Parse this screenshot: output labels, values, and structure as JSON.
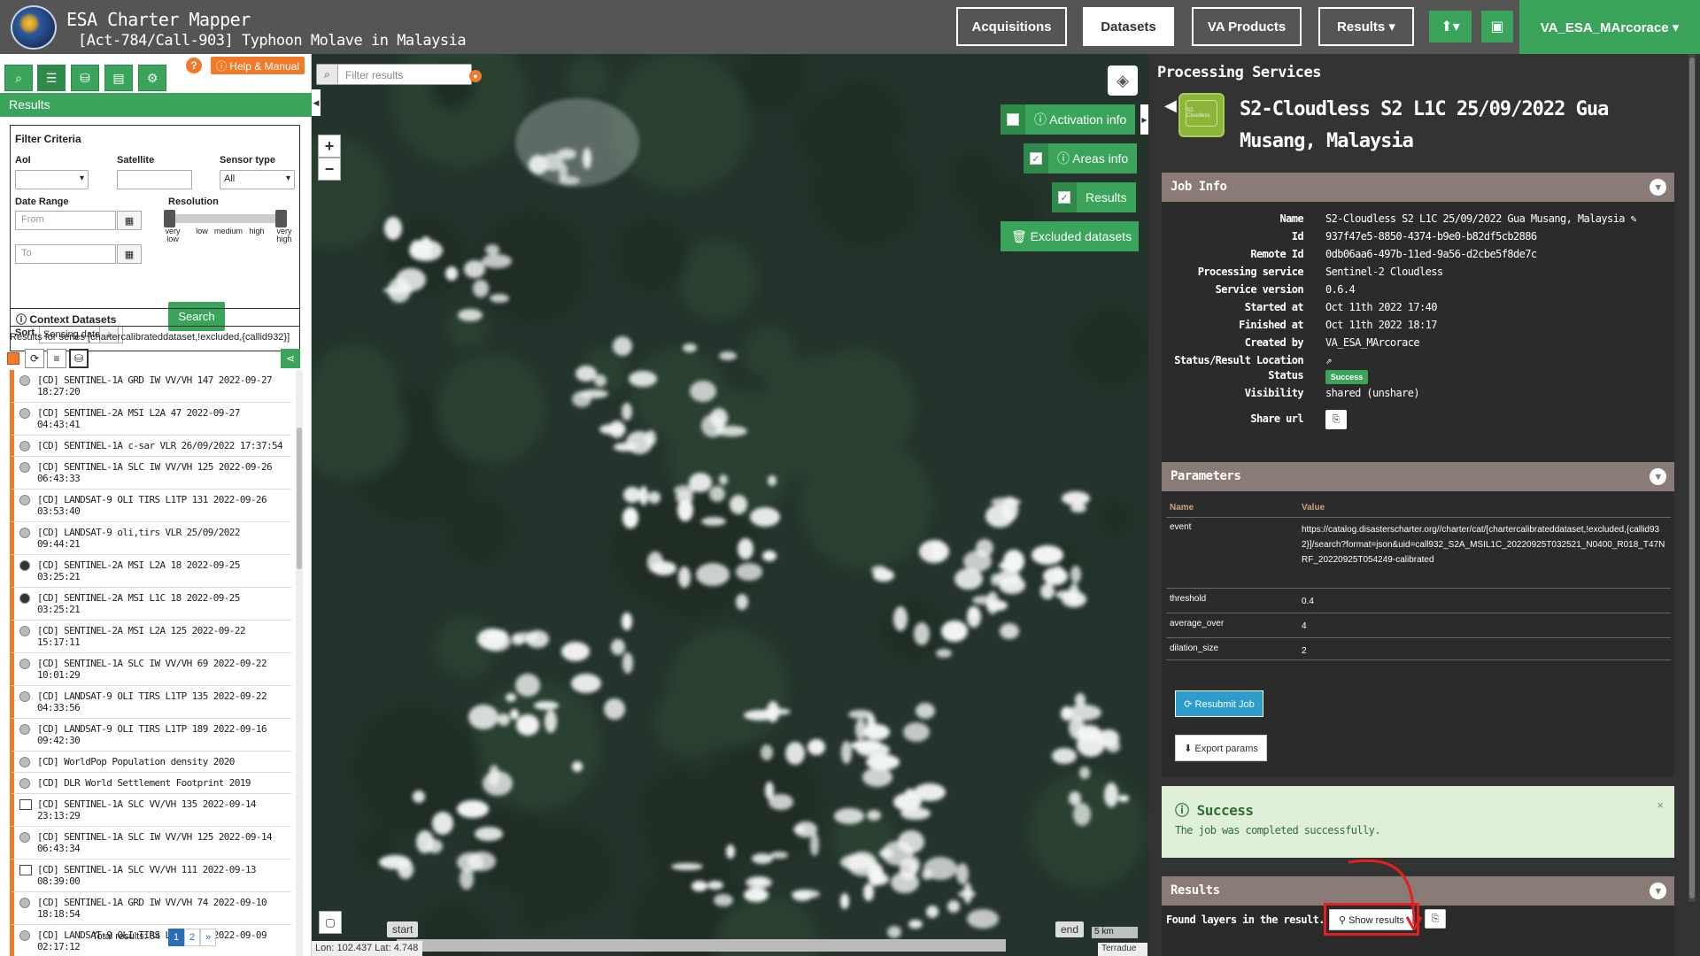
{
  "header": {
    "app_title": "ESA Charter Mapper",
    "activation_title": "[Act-784/Call-903] Typhoon Molave in Malaysia",
    "nav": [
      {
        "label": "Acquisitions"
      },
      {
        "label": "Datasets"
      },
      {
        "label": "VA Products"
      },
      {
        "label": "Results ▾"
      }
    ],
    "upload_label": "⬆▾",
    "briefcase_label": "▣",
    "user_label": "VA_ESA_MArcorace ▾"
  },
  "left_panel": {
    "help_q": "?",
    "help_manual": "ⓘ Help & Manual",
    "tab_icons": [
      "⌕",
      "☰",
      "⛁",
      "▤",
      "⚙"
    ],
    "results_title": "Results",
    "filter": {
      "title": "Filter Criteria",
      "aoi_label": "AoI",
      "aoi_value": "",
      "satellite_label": "Satellite",
      "satellite_value": "",
      "sensor_label": "Sensor type",
      "sensor_value": "All",
      "date_label": "Date Range",
      "from_placeholder": "From",
      "to_placeholder": "To",
      "resolution_label": "Resolution",
      "resolution_levels": [
        "very low",
        "low",
        "medium",
        "high",
        "very high"
      ],
      "search_label": "Search",
      "sort_label": "Sort",
      "sort_value": "Sensing date"
    },
    "context_title": "ⓘ Context Datasets",
    "series_text": "Results for series [chartercalibrateddataset,!excluded,{callid932}]",
    "datasets": [
      {
        "label": "[CD] SENTINEL-1A GRD IW VV/VH 147 2022-09-27 18:27:20",
        "icon": "grey"
      },
      {
        "label": "[CD] SENTINEL-2A MSI L2A 47 2022-09-27 04:43:41",
        "icon": "grey"
      },
      {
        "label": "[CD] SENTINEL-1A c-sar VLR 26/09/2022 17:37:54",
        "icon": "grey"
      },
      {
        "label": "[CD] SENTINEL-1A SLC IW VV/VH 125 2022-09-26 06:43:33",
        "icon": "grey"
      },
      {
        "label": "[CD] LANDSAT-9 OLI TIRS L1TP 131 2022-09-26 03:53:40",
        "icon": "grey"
      },
      {
        "label": "[CD] LANDSAT-9 oli,tirs VLR 25/09/2022 09:44:21",
        "icon": "grey"
      },
      {
        "label": "[CD] SENTINEL-2A MSI L2A 18 2022-09-25 03:25:21",
        "icon": "dark"
      },
      {
        "label": "[CD] SENTINEL-2A MSI L1C 18 2022-09-25 03:25:21",
        "icon": "dark"
      },
      {
        "label": "[CD] SENTINEL-2A MSI L2A 125 2022-09-22 15:17:11",
        "icon": "grey"
      },
      {
        "label": "[CD] SENTINEL-1A SLC IW VV/VH 69 2022-09-22 10:01:29",
        "icon": "grey"
      },
      {
        "label": "[CD] LANDSAT-9 OLI TIRS L1TP 135 2022-09-22 04:33:56",
        "icon": "grey"
      },
      {
        "label": "[CD] LANDSAT-9 OLI TIRS L1TP 189 2022-09-16 09:42:30",
        "icon": "grey"
      },
      {
        "label": "[CD] WorldPop Population density 2020",
        "icon": "grey"
      },
      {
        "label": "[CD] DLR World Settlement Footprint 2019",
        "icon": "grey"
      },
      {
        "label": "[CD] SENTINEL-1A SLC VV/VH 135 2022-09-14 23:13:29",
        "icon": "sq"
      },
      {
        "label": "[CD] SENTINEL-1A SLC IW VV/VH 125 2022-09-14 06:43:34",
        "icon": "grey"
      },
      {
        "label": "[CD] SENTINEL-1A SLC VV/VH 111 2022-09-13 08:39:00",
        "icon": "sq"
      },
      {
        "label": "[CD] SENTINEL-1A GRD IW VV/VH 74 2022-09-10 18:18:54",
        "icon": "grey"
      },
      {
        "label": "[CD] LANDSAT-9 OLI TIRS L1TP 116 2022-09-09 02:17:12",
        "icon": "grey"
      }
    ],
    "total_results": "Total results: 64",
    "pages": [
      "1",
      "2",
      "»"
    ]
  },
  "map": {
    "filter_placeholder": "Filter results",
    "zoom_in": "+",
    "zoom_out": "−",
    "toggles": [
      {
        "label": "ⓘ Activation info",
        "checked": false
      },
      {
        "label": "ⓘ Areas info",
        "checked": true
      },
      {
        "label": "Results",
        "checked": true
      }
    ],
    "excluded_label": "🗑 Excluded datasets",
    "timeline_start": "start",
    "timeline_end": "end",
    "coords": "Lon: 102.437 Lat: 4.748",
    "scale": "5 km",
    "attribution": "Terradue"
  },
  "right_panel": {
    "title": "Processing Services",
    "service_icon_text": "S2-Cloudless",
    "job_title": "S2-Cloudless S2 L1C 25/09/2022 Gua Musang, Malaysia",
    "job_info": {
      "title": "Job Info",
      "rows": [
        {
          "k": "Name",
          "v": "S2-Cloudless S2 L1C 25/09/2022 Gua Musang, Malaysia ✎"
        },
        {
          "k": "Id",
          "v": "937f47e5-8850-4374-b9e0-b82df5cb2886"
        },
        {
          "k": "Remote Id",
          "v": "0db06aa6-497b-11ed-9a56-d2cbe5f8de7c"
        },
        {
          "k": "Processing service",
          "v": "Sentinel-2 Cloudless"
        },
        {
          "k": "Service version",
          "v": "0.6.4"
        },
        {
          "k": "Started at",
          "v": "Oct 11th 2022 17:40"
        },
        {
          "k": "Finished at",
          "v": "Oct 11th 2022 18:17"
        },
        {
          "k": "Created by",
          "v": "VA_ESA_MArcorace"
        },
        {
          "k": "Status/Result Location",
          "v": "⇗"
        }
      ],
      "status_label": "Status",
      "status_value": "Success",
      "visibility_label": "Visibility",
      "visibility_value": "shared (unshare)",
      "share_label": "Share url",
      "share_icon": "⎘"
    },
    "parameters": {
      "title": "Parameters",
      "name_header": "Name",
      "value_header": "Value",
      "rows": [
        {
          "k": "event",
          "v": "https://catalog.disasterscharter.org//charter/cat/[chartercalibrateddataset,!excluded,{callid932}]/search?format=json&uid=call932_S2A_MSIL1C_20220925T032521_N0400_R018_T47NRF_20220925T054249-calibrated"
        },
        {
          "k": "threshold",
          "v": "0.4"
        },
        {
          "k": "average_over",
          "v": "4"
        },
        {
          "k": "dilation_size",
          "v": "2"
        }
      ],
      "resubmit_label": "⟳ Resubmit Job",
      "export_label": "⬇ Export params"
    },
    "success": {
      "title": "ⓘ Success",
      "message": "The job was completed successfully.",
      "close": "×"
    },
    "results": {
      "title": "Results",
      "found_label": "Found layers in the result.",
      "show_results_label": "⚲ Show results",
      "copy_icon": "⎘"
    }
  },
  "colors": {
    "header_bg": "#555555",
    "accent_green": "#3aa55a",
    "orange": "#f07a2a",
    "section_head": "#8a7b76",
    "panel_dark": "#333333",
    "highlight_red": "#e41f1f"
  }
}
